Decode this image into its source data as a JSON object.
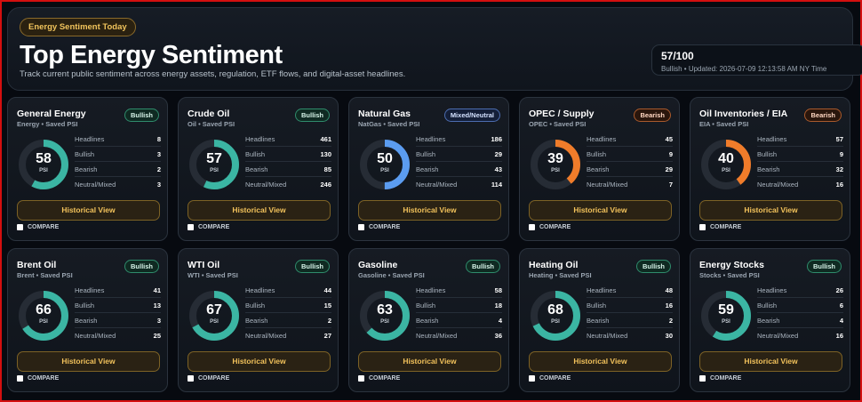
{
  "header": {
    "pill": "Energy Sentiment Today",
    "title": "Top Energy Sentiment",
    "subtitle": "Track current public sentiment across energy assets, regulation, ETF flows, and digital-asset headlines.",
    "score": "57/100",
    "score_meta": "Bullish • Updated: 2026-07-09 12:13:58 AM NY Time"
  },
  "labels": {
    "psi": "PSI",
    "headlines": "Headlines",
    "bullish": "Bullish",
    "bearish": "Bearish",
    "neutral": "Neutral/Mixed",
    "historical": "Historical View",
    "compare": "COMPARE"
  },
  "colors": {
    "teal": "#3bb5a3",
    "orange": "#f07c2a",
    "blue": "#5b9cf0",
    "track": "#262c35"
  },
  "cards": [
    {
      "name": "General Energy",
      "sub": "Energy • Saved PSI",
      "badge": "Bullish",
      "badge_type": "bullish",
      "psi": 58,
      "color": "teal",
      "headlines": 8,
      "bullish": 3,
      "bearish": 2,
      "neutral": 3
    },
    {
      "name": "Crude Oil",
      "sub": "Oil • Saved PSI",
      "badge": "Bullish",
      "badge_type": "bullish",
      "psi": 57,
      "color": "teal",
      "headlines": 461,
      "bullish": 130,
      "bearish": 85,
      "neutral": 246
    },
    {
      "name": "Natural Gas",
      "sub": "NatGas • Saved PSI",
      "badge": "Mixed/Neutral",
      "badge_type": "mixed",
      "psi": 50,
      "color": "blue",
      "headlines": 186,
      "bullish": 29,
      "bearish": 43,
      "neutral": 114
    },
    {
      "name": "OPEC / Supply",
      "sub": "OPEC • Saved PSI",
      "badge": "Bearish",
      "badge_type": "bearish",
      "psi": 39,
      "color": "orange",
      "headlines": 45,
      "bullish": 9,
      "bearish": 29,
      "neutral": 7
    },
    {
      "name": "Oil Inventories / EIA",
      "sub": "EIA • Saved PSI",
      "badge": "Bearish",
      "badge_type": "bearish",
      "psi": 40,
      "color": "orange",
      "headlines": 57,
      "bullish": 9,
      "bearish": 32,
      "neutral": 16
    },
    {
      "name": "Brent Oil",
      "sub": "Brent • Saved PSI",
      "badge": "Bullish",
      "badge_type": "bullish",
      "psi": 66,
      "color": "teal",
      "headlines": 41,
      "bullish": 13,
      "bearish": 3,
      "neutral": 25
    },
    {
      "name": "WTI Oil",
      "sub": "WTI • Saved PSI",
      "badge": "Bullish",
      "badge_type": "bullish",
      "psi": 67,
      "color": "teal",
      "headlines": 44,
      "bullish": 15,
      "bearish": 2,
      "neutral": 27
    },
    {
      "name": "Gasoline",
      "sub": "Gasoline • Saved PSI",
      "badge": "Bullish",
      "badge_type": "bullish",
      "psi": 63,
      "color": "teal",
      "headlines": 58,
      "bullish": 18,
      "bearish": 4,
      "neutral": 36
    },
    {
      "name": "Heating Oil",
      "sub": "Heating • Saved PSI",
      "badge": "Bullish",
      "badge_type": "bullish",
      "psi": 68,
      "color": "teal",
      "headlines": 48,
      "bullish": 16,
      "bearish": 2,
      "neutral": 30
    },
    {
      "name": "Energy Stocks",
      "sub": "Stocks • Saved PSI",
      "badge": "Bullish",
      "badge_type": "bullish",
      "psi": 59,
      "color": "teal",
      "headlines": 26,
      "bullish": 6,
      "bearish": 4,
      "neutral": 16
    }
  ]
}
